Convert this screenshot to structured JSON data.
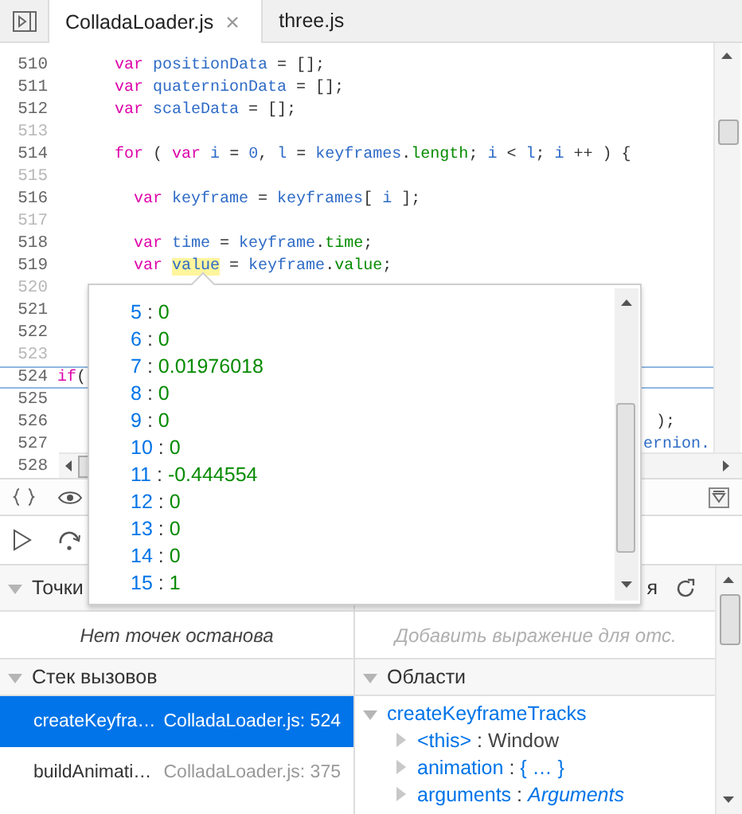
{
  "tabs": [
    {
      "label": "ColladaLoader.js",
      "selected": true,
      "closable": true
    },
    {
      "label": "three.js",
      "selected": false,
      "closable": false
    }
  ],
  "editor": {
    "lines": [
      {
        "number": "510",
        "dim": false,
        "paused": false,
        "tokens": [
          {
            "text": "      var",
            "kind": "keyword"
          },
          {
            "text": " positionData",
            "kind": "identifier"
          },
          {
            "text": " = [];",
            "kind": "punctuation"
          }
        ]
      },
      {
        "number": "511",
        "dim": false,
        "paused": false,
        "tokens": [
          {
            "text": "      var",
            "kind": "keyword"
          },
          {
            "text": " quaternionData",
            "kind": "identifier"
          },
          {
            "text": " = [];",
            "kind": "punctuation"
          }
        ]
      },
      {
        "number": "512",
        "dim": false,
        "paused": false,
        "tokens": [
          {
            "text": "      var",
            "kind": "keyword"
          },
          {
            "text": " scaleData",
            "kind": "identifier"
          },
          {
            "text": " = [];",
            "kind": "punctuation"
          }
        ]
      },
      {
        "number": "513",
        "dim": true,
        "paused": false
      },
      {
        "number": "514",
        "dim": false,
        "paused": false,
        "tokens": [
          {
            "text": "      for",
            "kind": "keyword"
          },
          {
            "text": " ( ",
            "kind": "punctuation"
          },
          {
            "text": "var",
            "kind": "keyword"
          },
          {
            "text": " i",
            "kind": "identifier"
          },
          {
            "text": " = ",
            "kind": "punctuation"
          },
          {
            "text": "0",
            "kind": "number"
          },
          {
            "text": ", ",
            "kind": "punctuation"
          },
          {
            "text": "l",
            "kind": "identifier"
          },
          {
            "text": " = ",
            "kind": "punctuation"
          },
          {
            "text": "keyframes",
            "kind": "identifier"
          },
          {
            "text": ".",
            "kind": "punctuation"
          },
          {
            "text": "length",
            "kind": "property"
          },
          {
            "text": "; ",
            "kind": "punctuation"
          },
          {
            "text": "i",
            "kind": "identifier"
          },
          {
            "text": " < ",
            "kind": "punctuation"
          },
          {
            "text": "l",
            "kind": "identifier"
          },
          {
            "text": "; ",
            "kind": "punctuation"
          },
          {
            "text": "i",
            "kind": "identifier"
          },
          {
            "text": " ++ ) {",
            "kind": "punctuation"
          }
        ]
      },
      {
        "number": "515",
        "dim": true,
        "paused": false
      },
      {
        "number": "516",
        "dim": false,
        "paused": false,
        "tokens": [
          {
            "text": "        var",
            "kind": "keyword"
          },
          {
            "text": " keyframe",
            "kind": "identifier"
          },
          {
            "text": " = ",
            "kind": "punctuation"
          },
          {
            "text": "keyframes",
            "kind": "identifier"
          },
          {
            "text": "[ ",
            "kind": "punctuation"
          },
          {
            "text": "i",
            "kind": "identifier"
          },
          {
            "text": " ];",
            "kind": "punctuation"
          }
        ]
      },
      {
        "number": "517",
        "dim": true,
        "paused": false
      },
      {
        "number": "518",
        "dim": false,
        "paused": false,
        "tokens": [
          {
            "text": "        var",
            "kind": "keyword"
          },
          {
            "text": " time",
            "kind": "identifier"
          },
          {
            "text": " = ",
            "kind": "punctuation"
          },
          {
            "text": "keyframe",
            "kind": "identifier"
          },
          {
            "text": ".",
            "kind": "punctuation"
          },
          {
            "text": "time",
            "kind": "property"
          },
          {
            "text": ";",
            "kind": "punctuation"
          }
        ]
      },
      {
        "number": "519",
        "dim": false,
        "paused": false,
        "tokens": [
          {
            "text": "        var ",
            "kind": "keyword"
          },
          {
            "text": "value",
            "kind": "highlight"
          },
          {
            "text": " = ",
            "kind": "punctuation"
          },
          {
            "text": "keyframe",
            "kind": "identifier"
          },
          {
            "text": ".",
            "kind": "punctuation"
          },
          {
            "text": "value",
            "kind": "property"
          },
          {
            "text": ";",
            "kind": "punctuation"
          }
        ]
      },
      {
        "number": "520",
        "dim": true,
        "paused": false
      },
      {
        "number": "521",
        "dim": false,
        "paused": false
      },
      {
        "number": "522",
        "dim": false,
        "paused": false
      },
      {
        "number": "523",
        "dim": true,
        "paused": false
      },
      {
        "number": "524",
        "dim": false,
        "paused": true,
        "tokens": [
          {
            "text": "if",
            "kind": "keyword"
          },
          {
            "text": "(",
            "kind": "punctuation"
          }
        ]
      },
      {
        "number": "525",
        "dim": false,
        "paused": false
      },
      {
        "number": "526",
        "dim": false,
        "paused": false,
        "tail": ");"
      },
      {
        "number": "527",
        "dim": false,
        "paused": false,
        "tail": "ernion."
      },
      {
        "number": "528",
        "dim": false,
        "paused": false
      }
    ]
  },
  "popup": {
    "rows": [
      {
        "key": "5",
        "separator": ":",
        "value": "0"
      },
      {
        "key": "6",
        "separator": ":",
        "value": "0"
      },
      {
        "key": "7",
        "separator": ":",
        "value": "0.01976018"
      },
      {
        "key": "8",
        "separator": ":",
        "value": "0"
      },
      {
        "key": "9",
        "separator": ":",
        "value": "0"
      },
      {
        "key": "10",
        "separator": ":",
        "value": "0"
      },
      {
        "key": "11",
        "separator": ":",
        "value": "-0.444554"
      },
      {
        "key": "12",
        "separator": ":",
        "value": "0"
      },
      {
        "key": "13",
        "separator": ":",
        "value": "0"
      },
      {
        "key": "14",
        "separator": ":",
        "value": "0"
      },
      {
        "key": "15",
        "separator": ":",
        "value": "1"
      }
    ]
  },
  "breakpoints": {
    "title": "Точки",
    "empty": "Нет точек останова"
  },
  "watch": {
    "title": "я",
    "placeholder": "Добавить выражение для отс."
  },
  "call_stack": {
    "title": "Стек вызовов",
    "frames": [
      {
        "function": "createKeyfra…",
        "location": "ColladaLoader.js: 524",
        "selected": true
      },
      {
        "function": "buildAnimati…",
        "location": "ColladaLoader.js: 375",
        "selected": false
      }
    ]
  },
  "scopes": {
    "title": "Области",
    "scope": {
      "name": "createKeyframeTracks",
      "expanded": true,
      "children": [
        {
          "name": "<this>",
          "separator": ":",
          "value": "Window",
          "kind": "plain"
        },
        {
          "name": "animation",
          "separator": ":",
          "value": "{ … }",
          "kind": "preview"
        },
        {
          "name": "arguments",
          "separator": ":",
          "value": "Arguments",
          "kind": "class"
        }
      ]
    }
  }
}
